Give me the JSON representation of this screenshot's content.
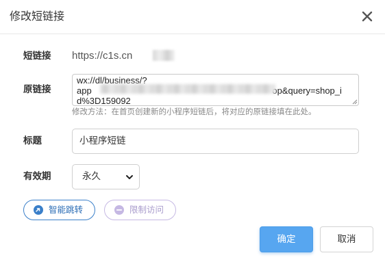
{
  "dialog": {
    "title": "修改短链接"
  },
  "form": {
    "short_label": "短链接",
    "short_value": "https://c1s.cn",
    "original_label": "原链接",
    "original_value": "wx://dl/business/?\napp                                                                         op&query=shop_id%3D159092",
    "hint": "修改方法：在首页创建新的小程序短链后，将对应的原链接填在此处。",
    "title_label": "标题",
    "title_value": "小程序短链",
    "validity_label": "有效期",
    "validity_selected": "永久"
  },
  "pills": {
    "smart_jump": "智能跳转",
    "limit_access": "限制访问"
  },
  "buttons": {
    "ok": "确定",
    "cancel": "取消"
  },
  "colors": {
    "primary": "#57a6f0",
    "smart_pill": "#3a7fc9",
    "limit_pill": "#c5b8e3",
    "hint": "#888888"
  },
  "icons": {
    "close": "close-icon",
    "smart_jump": "arrow-circle-icon",
    "limit_access": "minus-circle-icon",
    "select": "chevron-down-icon"
  }
}
